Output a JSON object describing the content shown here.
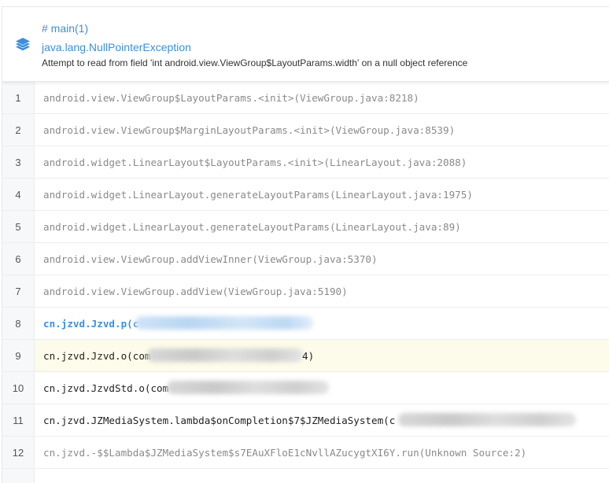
{
  "header": {
    "thread": "# main(1)",
    "exception": "java.lang.NullPointerException",
    "message": "Attempt to read from field 'int android.view.ViewGroup$LayoutParams.width' on a null object reference",
    "icon": "layers-icon"
  },
  "frames": [
    {
      "line": "1",
      "text": "android.view.ViewGroup$LayoutParams.<init>(ViewGroup.java:8218)"
    },
    {
      "line": "2",
      "text": "android.view.ViewGroup$MarginLayoutParams.<init>(ViewGroup.java:8539)"
    },
    {
      "line": "3",
      "text": "android.widget.LinearLayout$LayoutParams.<init>(LinearLayout.java:2088)"
    },
    {
      "line": "4",
      "text": "android.widget.LinearLayout.generateLayoutParams(LinearLayout.java:1975)"
    },
    {
      "line": "5",
      "text": "android.widget.LinearLayout.generateLayoutParams(LinearLayout.java:89)"
    },
    {
      "line": "6",
      "text": "android.view.ViewGroup.addViewInner(ViewGroup.java:5370)"
    },
    {
      "line": "7",
      "text": "android.view.ViewGroup.addView(ViewGroup.java:5190)"
    },
    {
      "line": "8",
      "text": "cn.jzvd.Jzvd.p(c"
    },
    {
      "line": "9",
      "text": "cn.jzvd.Jzvd.o(com",
      "tail": "4)"
    },
    {
      "line": "10",
      "text": "cn.jzvd.JzvdStd.o(com"
    },
    {
      "line": "11",
      "text": "cn.jzvd.JZMediaSystem.lambda$onCompletion$7$JZMediaSystem(c"
    },
    {
      "line": "12",
      "text": "cn.jzvd.-$$Lambda$JZMediaSystem$s7EAuXFloE1cNvllAZucygtXI6Y.run(Unknown Source:2)"
    }
  ],
  "colors": {
    "accent": "#3d8fdc",
    "highlight_row": "#fdfbe9"
  }
}
